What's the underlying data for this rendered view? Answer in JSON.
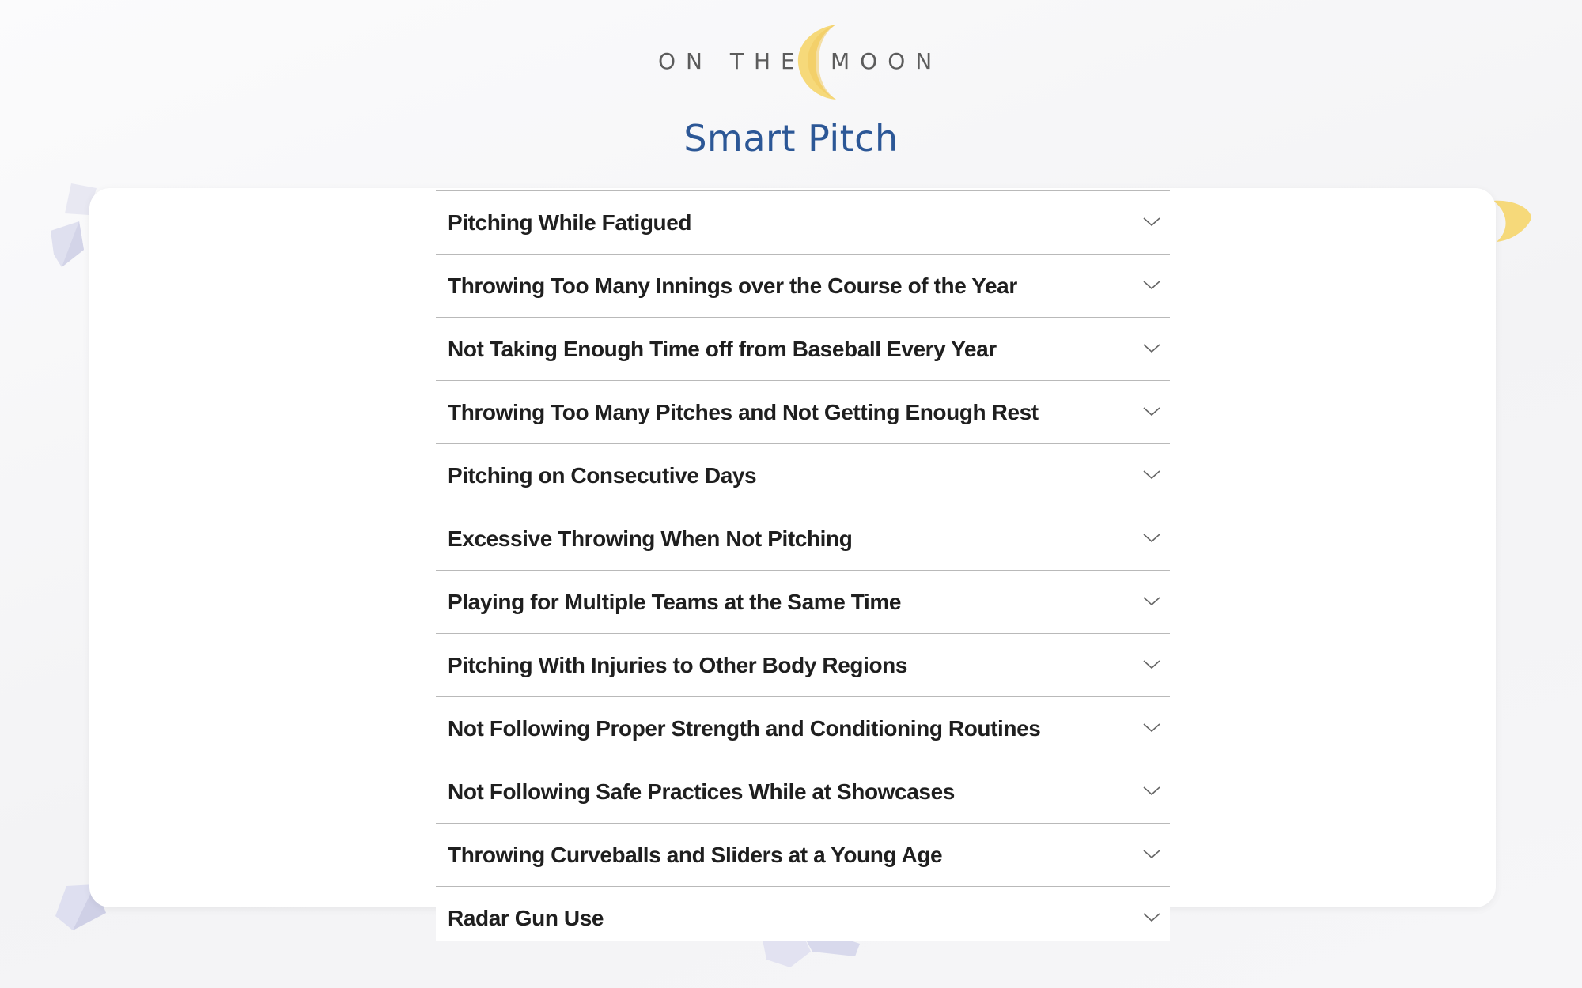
{
  "brand": {
    "logo_left": "ON THE",
    "logo_right": "MOON",
    "moon_color": "#f6d97a"
  },
  "page": {
    "title": "Smart Pitch",
    "title_color": "#2c5796"
  },
  "accordion": {
    "items": [
      {
        "label": "Pitching While Fatigued",
        "icon": "chevron-down-icon"
      },
      {
        "label": "Throwing Too Many Innings over the Course of the Year",
        "icon": "chevron-down-icon"
      },
      {
        "label": "Not Taking Enough Time off from Baseball Every Year",
        "icon": "chevron-down-icon"
      },
      {
        "label": "Throwing Too Many Pitches and Not Getting Enough Rest",
        "icon": "chevron-down-icon"
      },
      {
        "label": "Pitching on Consecutive Days",
        "icon": "chevron-down-icon"
      },
      {
        "label": "Excessive Throwing When Not Pitching",
        "icon": "chevron-down-icon"
      },
      {
        "label": "Playing for Multiple Teams at the Same Time",
        "icon": "chevron-down-icon"
      },
      {
        "label": "Pitching With Injuries to Other Body Regions",
        "icon": "chevron-down-icon"
      },
      {
        "label": "Not Following Proper Strength and Conditioning Routines",
        "icon": "chevron-down-icon"
      },
      {
        "label": "Not Following Safe Practices While at Showcases",
        "icon": "chevron-down-icon"
      },
      {
        "label": "Throwing Curveballs and Sliders at a Young Age",
        "icon": "chevron-down-icon"
      },
      {
        "label": "Radar Gun Use",
        "icon": "chevron-down-icon"
      }
    ]
  }
}
